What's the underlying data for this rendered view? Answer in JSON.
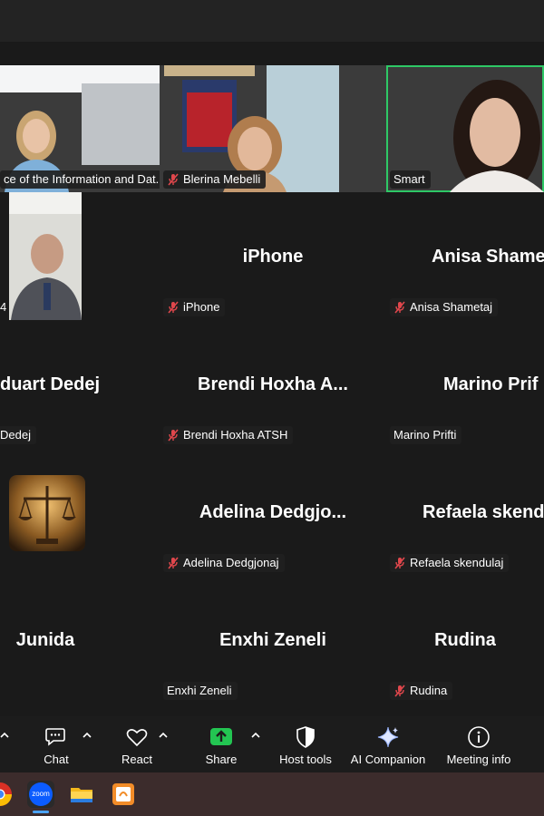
{
  "tiles": [
    {
      "id": "t1",
      "label": "ce of the Information and Dat...",
      "muted": false,
      "video": true
    },
    {
      "id": "t2",
      "label": "Blerina Mebelli",
      "muted": true,
      "video": true
    },
    {
      "id": "t3",
      "label": "Smart",
      "muted": false,
      "video": true,
      "active": true
    },
    {
      "id": "t4",
      "label": "4",
      "muted": false,
      "video": true
    },
    {
      "id": "t5",
      "big": "iPhone",
      "label": "iPhone",
      "muted": true
    },
    {
      "id": "t6",
      "big": "Anisa Shame",
      "label": "Anisa Shametaj",
      "muted": true
    },
    {
      "id": "t7",
      "big": "duart Dedej",
      "label": "Dedej",
      "muted": false
    },
    {
      "id": "t8",
      "big": "Brendi Hoxha A...",
      "label": "Brendi Hoxha ATSH",
      "muted": true
    },
    {
      "id": "t9",
      "big": "Marino Prif",
      "label": "Marino Prifti",
      "muted": false
    },
    {
      "id": "t10",
      "avatar": "justice-scales",
      "muted": false
    },
    {
      "id": "t11",
      "big": "Adelina Dedgjo...",
      "label": "Adelina Dedgjonaj",
      "muted": true
    },
    {
      "id": "t12",
      "big": "Refaela skend",
      "label": "Refaela skendulaj",
      "muted": true
    },
    {
      "id": "t13",
      "big": "Junida"
    },
    {
      "id": "t14",
      "big": "Enxhi Zeneli",
      "label": "Enxhi Zeneli",
      "muted": false
    },
    {
      "id": "t15",
      "big": "Rudina",
      "label": "Rudina",
      "muted": true
    }
  ],
  "toolbar": {
    "chat": "Chat",
    "react": "React",
    "share": "Share",
    "host_tools": "Host tools",
    "ai_companion": "AI Companion",
    "meeting_info": "Meeting info"
  },
  "taskbar": {
    "zoom_label": "zoom"
  },
  "colors": {
    "active_speaker": "#2ec866",
    "share_green": "#23c552",
    "muted_red": "#e0474c"
  }
}
